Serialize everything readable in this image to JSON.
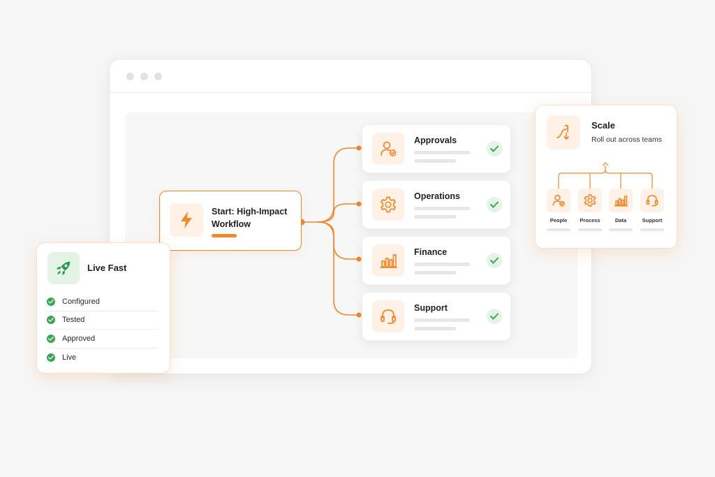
{
  "workflow": {
    "start": {
      "title": "Start: High-Impact Workflow",
      "icon": "lightning-icon"
    },
    "departments": [
      {
        "label": "Approvals",
        "icon": "user-check-icon",
        "status": "done"
      },
      {
        "label": "Operations",
        "icon": "gear-icon",
        "status": "done"
      },
      {
        "label": "Finance",
        "icon": "bar-chart-icon",
        "status": "done"
      },
      {
        "label": "Support",
        "icon": "headset-icon",
        "status": "done"
      }
    ]
  },
  "live_fast": {
    "title": "Live Fast",
    "icon": "rocket-icon",
    "items": [
      "Configured",
      "Tested",
      "Approved",
      "Live"
    ]
  },
  "scale": {
    "title": "Scale",
    "subtitle": "Roll out across teams",
    "icon": "split-arrows-icon",
    "teams": [
      {
        "label": "People",
        "icon": "user-check-icon"
      },
      {
        "label": "Process",
        "icon": "gear-icon"
      },
      {
        "label": "Data",
        "icon": "bar-chart-icon"
      },
      {
        "label": "Support",
        "icon": "headset-icon"
      }
    ]
  },
  "colors": {
    "accent": "#f4872a",
    "accent_soft": "#fff1e6",
    "success": "#3aa655",
    "success_soft": "#e3f3e6"
  }
}
